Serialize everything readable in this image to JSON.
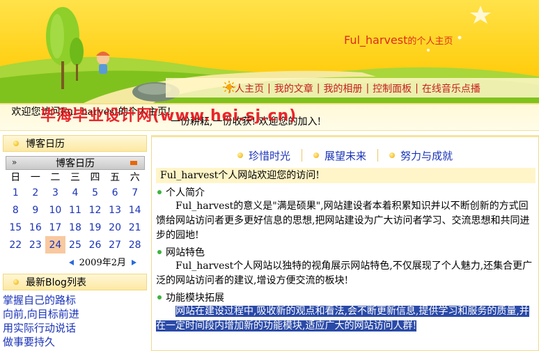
{
  "header": {
    "site_title": "Ful_harvest",
    "site_title_suffix": "的个人主页",
    "nav": [
      "个人主页",
      "我的文章",
      "我的相册",
      "控制面板",
      "在线音乐点播"
    ],
    "nav_separator": "|"
  },
  "welcome": {
    "text": "欢迎您访问Ful_harvest的个人主页!",
    "marquee": "一份耕耘,一份收获! 欢迎您的加入!",
    "watermark": "毕海毕业设计网(www.hei.sj.cn)"
  },
  "sidebar": {
    "calendar_box_title": "博客日历",
    "calendar": {
      "nav_prev": "»",
      "title": "博客日历",
      "weekdays": [
        "日",
        "一",
        "二",
        "三",
        "四",
        "五",
        "六"
      ],
      "rows": [
        [
          "1",
          "2",
          "3",
          "4",
          "5",
          "6",
          "7"
        ],
        [
          "8",
          "9",
          "10",
          "11",
          "12",
          "13",
          "14"
        ],
        [
          "15",
          "16",
          "17",
          "18",
          "19",
          "20",
          "21"
        ],
        [
          "22",
          "23",
          "24",
          "25",
          "26",
          "27",
          "28"
        ]
      ],
      "today": "24",
      "month_label": "2009年2月"
    },
    "blog_box_title": "最新Blog列表",
    "blog_list": [
      "掌握自己的路标",
      "向前,向目标前进",
      "用实际行动说话",
      "做事要持久"
    ]
  },
  "main": {
    "tabs": [
      "珍惜时光",
      "展望未来",
      "努力与成就"
    ],
    "greeting": "Ful_harvest个人网站欢迎您的访问!",
    "sections": [
      {
        "title": "个人简介",
        "body": "Ful_harvest的意义是\"满是硕果\",网站建设者本着积累知识并以不断创新的方式回馈给网站访问者更多更好信息的思想,把网站建设为广大访问者学习、交流思想和共同进步的园地!"
      },
      {
        "title": "网站特色",
        "body": "Ful_harvest个人网站以独特的视角展示网站特色,不仅展现了个人魅力,还集合更广泛的网站访问者的建议,增设方便交流的板块!"
      },
      {
        "title": "功能模块拓展",
        "body": "网站在建设过程中,吸收新的观点和看法,会不断更新信息,提供学习和服务的质量,并在一定时间段内增加新的功能模块,适应广大的网站访问人群!"
      }
    ]
  },
  "colors": {
    "banner": "#ffd21a",
    "nav_text": "#c81e1e",
    "link": "#1a33b8",
    "today": "#f8c9a0",
    "highlight": "#2a4aa8"
  }
}
